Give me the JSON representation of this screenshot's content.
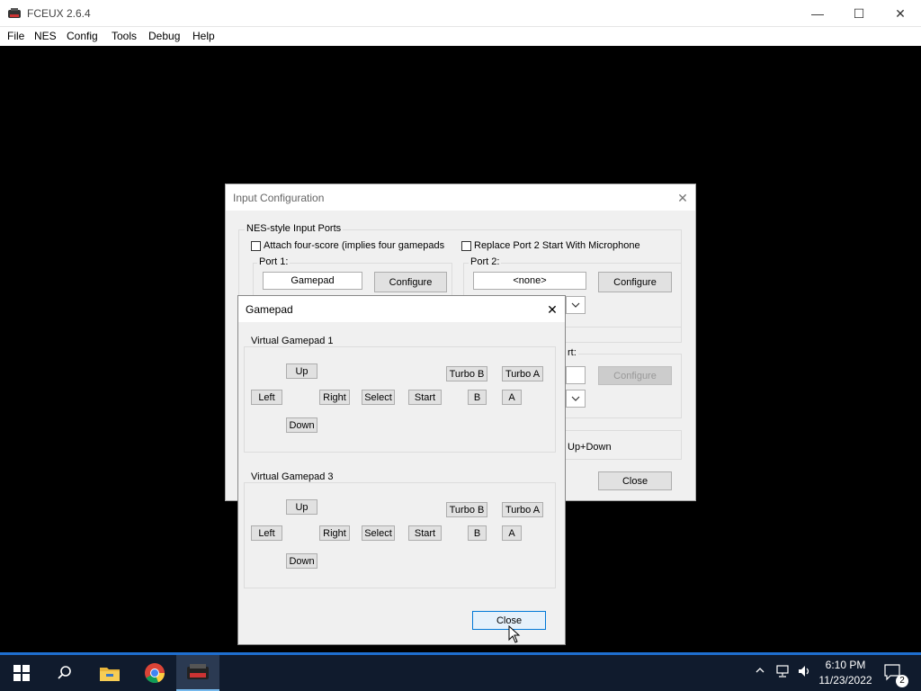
{
  "app": {
    "title": "FCEUX 2.6.4"
  },
  "window_controls": {
    "minimize": "—",
    "maximize": "☐",
    "close": "✕"
  },
  "menu": [
    "File",
    "NES",
    "Config",
    "Tools",
    "Debug",
    "Help"
  ],
  "input_config": {
    "title": "Input Configuration",
    "close_icon": "✕",
    "ports_group": "NES-style Input Ports",
    "attach_four_score": "Attach four-score (implies four gamepads",
    "replace_port2": "Replace Port 2 Start With Microphone",
    "port1_label": "Port 1:",
    "port1_device": "Gamepad",
    "port1_configure": "Configure",
    "port2_label": "Port 2:",
    "port2_device": "<none>",
    "port2_configure": "Configure",
    "famicom_label_fragment": "rt:",
    "famicom_configure": "Configure",
    "updown_fragment": "Up+Down",
    "close": "Close"
  },
  "gamepad": {
    "title": "Gamepad",
    "close_icon": "✕",
    "pads": [
      {
        "title": "Virtual Gamepad 1",
        "buttons": {
          "up": "Up",
          "left": "Left",
          "right": "Right",
          "down": "Down",
          "select": "Select",
          "start": "Start",
          "turbo_b": "Turbo B",
          "turbo_a": "Turbo A",
          "b": "B",
          "a": "A"
        }
      },
      {
        "title": "Virtual Gamepad 3",
        "buttons": {
          "up": "Up",
          "left": "Left",
          "right": "Right",
          "down": "Down",
          "select": "Select",
          "start": "Start",
          "turbo_b": "Turbo B",
          "turbo_a": "Turbo A",
          "b": "B",
          "a": "A"
        }
      }
    ],
    "close": "Close"
  },
  "taskbar": {
    "time": "6:10 PM",
    "date": "11/23/2022",
    "notification_count": "2",
    "icons": [
      "windows-start-icon",
      "search-icon",
      "file-explorer-icon",
      "chrome-icon",
      "fceux-taskbar-icon"
    ]
  },
  "colors": {
    "taskbar": "#101b2d",
    "accent": "#0078d7",
    "dialog_bg": "#f0f0f0"
  }
}
